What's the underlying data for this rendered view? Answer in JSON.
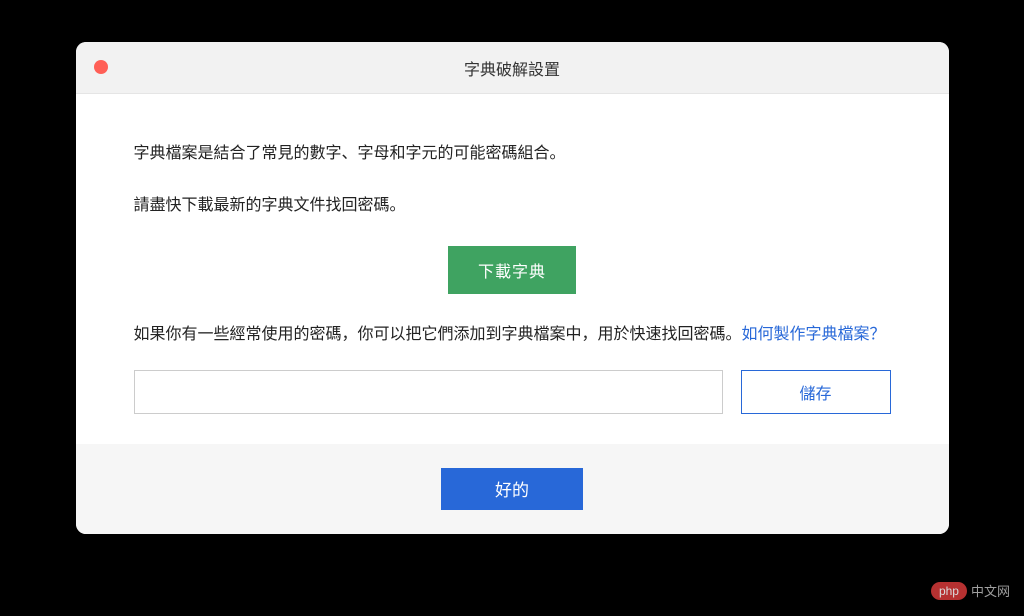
{
  "window": {
    "title": "字典破解設置"
  },
  "content": {
    "para1": "字典檔案是結合了常見的數字、字母和字元的可能密碼組合。",
    "para2": "請盡快下載最新的字典文件找回密碼。",
    "download_label": "下載字典",
    "help_pre": "如果你有一些經常使用的密碼，你可以把它們添加到字典檔案中，用於快速找回密碼。",
    "help_link": "如何製作字典檔案？",
    "input_value": "",
    "save_label": "儲存"
  },
  "footer": {
    "ok_label": "好的"
  },
  "watermark": {
    "badge": "php",
    "text": "中文网"
  }
}
